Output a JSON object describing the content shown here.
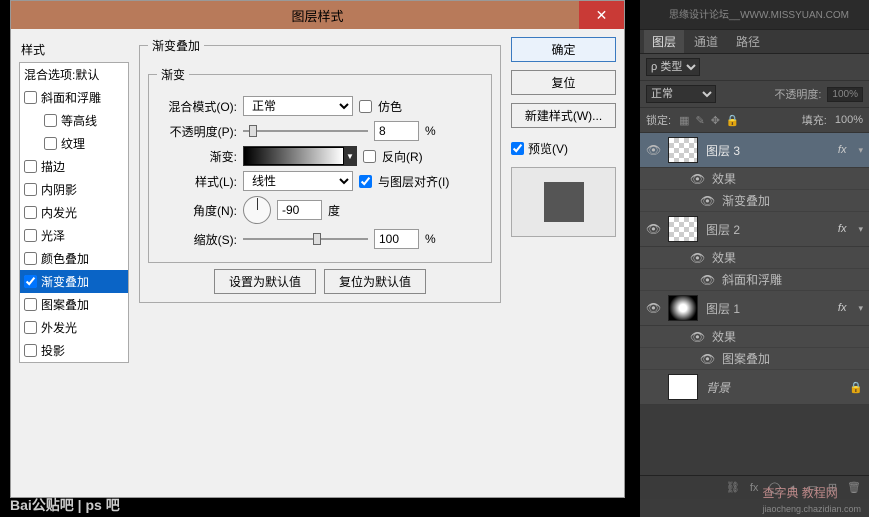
{
  "dialog": {
    "title": "图层样式",
    "close": "✕",
    "leftTitle": "样式",
    "leftItems": {
      "opt0": "混合选项:默认",
      "opt1": "斜面和浮雕",
      "opt1a": "等高线",
      "opt1b": "纹理",
      "opt2": "描边",
      "opt3": "内阴影",
      "opt4": "内发光",
      "opt5": "光泽",
      "opt6": "颜色叠加",
      "opt7": "渐变叠加",
      "opt8": "图案叠加",
      "opt9": "外发光",
      "opt10": "投影"
    },
    "group": {
      "outerLegend": "渐变叠加",
      "innerLegend": "渐变",
      "blendLabel": "混合模式(O):",
      "blendValue": "正常",
      "ditherLabel": "仿色",
      "opacityLabel": "不透明度(P):",
      "opacityValue": "8",
      "pct": "%",
      "gradientLabel": "渐变:",
      "reverseLabel": "反向(R)",
      "styleLabel": "样式(L):",
      "styleValue": "线性",
      "alignLabel": "与图层对齐(I)",
      "angleLabel": "角度(N):",
      "angleValue": "-90",
      "angleUnit": "度",
      "scaleLabel": "缩放(S):",
      "scaleValue": "100",
      "btnDefault": "设置为默认值",
      "btnReset": "复位为默认值"
    },
    "right": {
      "ok": "确定",
      "cancel": "复位",
      "newStyle": "新建样式(W)...",
      "preview": "预览(V)"
    }
  },
  "panel": {
    "topText": "思缘设计论坛__WWW.MISSYUAN.COM",
    "tabs": {
      "layers": "图层",
      "channels": "通道",
      "paths": "路径"
    },
    "kindLabel": "ρ 类型",
    "modeValue": "正常",
    "opacityLabel": "不透明度:",
    "opacityValue": "100%",
    "lockLabel": "锁定:",
    "fillLabel": "填充:",
    "fillValue": "100%",
    "layers": {
      "l3": "图层 3",
      "l2": "图层 2",
      "l1": "图层 1",
      "bg": "背景",
      "fx": "fx",
      "effects": "效果",
      "gradOverlay": "渐变叠加",
      "bevel": "斜面和浮雕",
      "patternOverlay": "图案叠加"
    }
  },
  "watermarks": {
    "br1": "查字典 教程网",
    "br2": "jiaocheng.chazidian.com",
    "bl": "Bai公贴吧 | ps 吧"
  }
}
